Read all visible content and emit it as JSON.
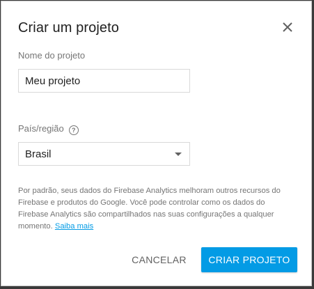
{
  "dialog": {
    "title": "Criar um projeto",
    "close_icon": "close-icon"
  },
  "project_name": {
    "label": "Nome do projeto",
    "value": "Meu projeto"
  },
  "region": {
    "label": "País/região",
    "help_icon": "help-circle-icon",
    "selected": "Brasil",
    "dropdown_icon": "caret-down-icon"
  },
  "info": {
    "text": "Por padrão, seus dados do Firebase Analytics melhoram outros recursos do Firebase e produtos do Google. Você pode controlar como os dados do Firebase Analytics são compartilhados nas suas configurações a qualquer momento.",
    "link": "Saiba mais"
  },
  "actions": {
    "cancel": "CANCELAR",
    "create": "CRIAR PROJETO"
  },
  "colors": {
    "primary": "#039be5",
    "link": "#039be5"
  }
}
